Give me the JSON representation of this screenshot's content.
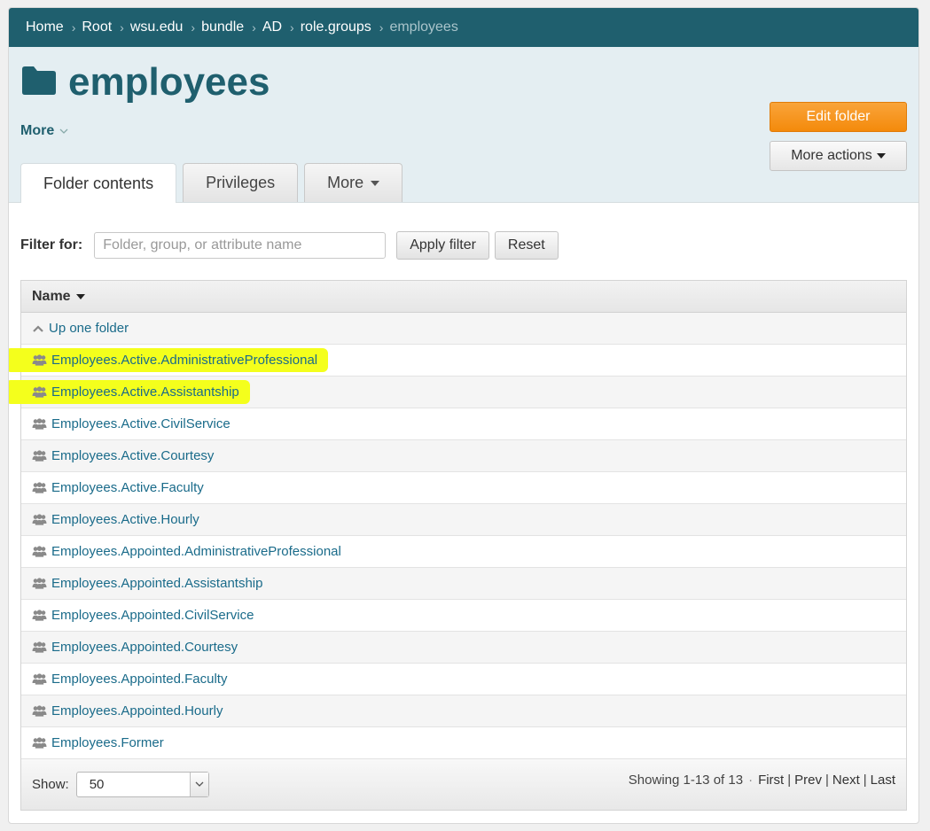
{
  "breadcrumb": [
    "Home",
    "Root",
    "wsu.edu",
    "bundle",
    "AD",
    "role.groups"
  ],
  "breadcrumb_current": "employees",
  "title": "employees",
  "more_link": "More",
  "buttons": {
    "edit_folder": "Edit folder",
    "more_actions": "More actions"
  },
  "tabs": {
    "folder_contents": "Folder contents",
    "privileges": "Privileges",
    "more": "More"
  },
  "filter": {
    "label": "Filter for:",
    "placeholder": "Folder, group, or attribute name",
    "value": "",
    "apply": "Apply filter",
    "reset": "Reset"
  },
  "table": {
    "header": "Name",
    "up_one_folder": "Up one folder",
    "rows": [
      "Employees.Active.AdministrativeProfessional",
      "Employees.Active.Assistantship",
      "Employees.Active.CivilService",
      "Employees.Active.Courtesy",
      "Employees.Active.Faculty",
      "Employees.Active.Hourly",
      "Employees.Appointed.AdministrativeProfessional",
      "Employees.Appointed.Assistantship",
      "Employees.Appointed.CivilService",
      "Employees.Appointed.Courtesy",
      "Employees.Appointed.Faculty",
      "Employees.Appointed.Hourly",
      "Employees.Former"
    ],
    "highlighted_rows": [
      0,
      1
    ]
  },
  "footer": {
    "show_label": "Show:",
    "show_value": "50",
    "showing": "Showing 1-13 of 13",
    "first": "First",
    "prev": "Prev",
    "next": "Next",
    "last": "Last"
  },
  "colors": {
    "header_bar": "#1f5f6e",
    "accent_orange": "#f48a0b",
    "highlight": "#f4ff1c",
    "link": "#1a6b8a"
  }
}
